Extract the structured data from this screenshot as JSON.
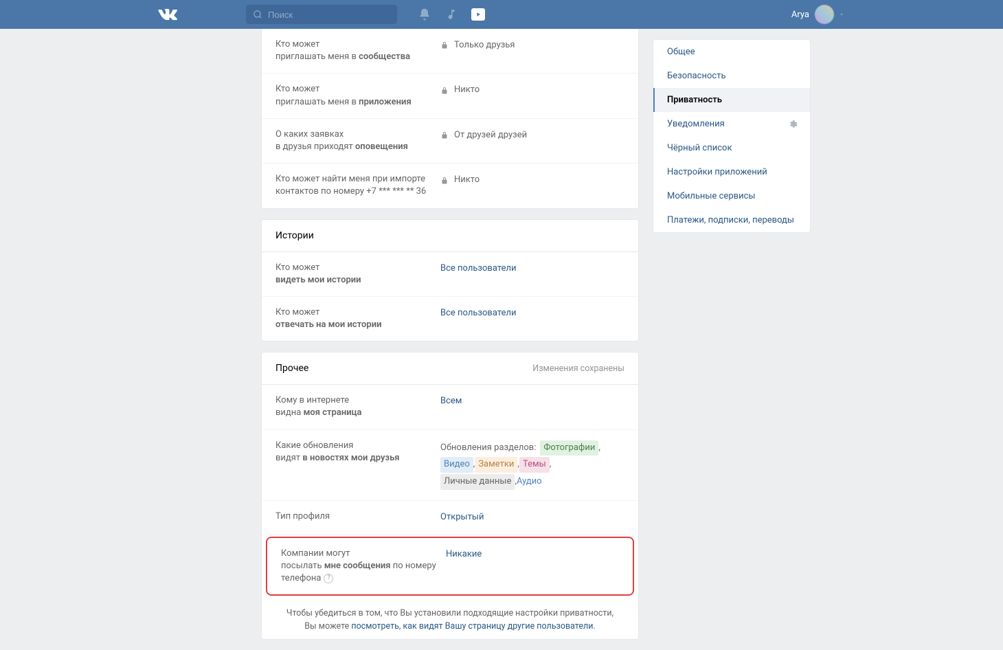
{
  "header": {
    "search_placeholder": "Поиск",
    "user_name": "Arya"
  },
  "sidebar": {
    "items": [
      {
        "label": "Общее",
        "active": false,
        "gear": false
      },
      {
        "label": "Безопасность",
        "active": false,
        "gear": false
      },
      {
        "label": "Приватность",
        "active": true,
        "gear": false
      },
      {
        "label": "Уведомления",
        "active": false,
        "gear": true
      },
      {
        "label": "Чёрный список",
        "active": false,
        "gear": false
      },
      {
        "label": "Настройки приложений",
        "active": false,
        "gear": false
      },
      {
        "label": "Мобильные сервисы",
        "active": false,
        "gear": false
      },
      {
        "label": "Платежи, подписки, переводы",
        "active": false,
        "gear": false
      }
    ]
  },
  "main": {
    "top_rows": [
      {
        "label_pre": "Кто может\nприглашать меня в ",
        "label_bold": "сообщества",
        "label_post": "",
        "value": "Только друзья",
        "locked": true
      },
      {
        "label_pre": "Кто может\nприглашать меня в ",
        "label_bold": "приложения",
        "label_post": "",
        "value": "Никто",
        "locked": true
      },
      {
        "label_pre": "О каких заявках\nв друзья приходят ",
        "label_bold": "оповещения",
        "label_post": "",
        "value": "От друзей друзей",
        "locked": true
      },
      {
        "label_pre": "Кто может найти меня при импорте контактов по номеру +7 *** *** ** 36",
        "label_bold": "",
        "label_post": "",
        "value": "Никто",
        "locked": true
      }
    ],
    "stories": {
      "title": "Истории",
      "rows": [
        {
          "label_pre": "Кто может\n",
          "label_bold": "видеть мои истории",
          "value": "Все пользователи"
        },
        {
          "label_pre": "Кто может\n",
          "label_bold": "отвечать на мои истории",
          "value": "Все пользователи"
        }
      ]
    },
    "other": {
      "title": "Прочее",
      "saved_text": "Изменения сохранены",
      "rows": [
        {
          "label_pre": "Кому в интернете\nвидна ",
          "label_bold": "моя страница",
          "value": "Всем",
          "type": "simple"
        },
        {
          "label_pre": "Какие обновления\nвидят ",
          "label_bold": "в новостях мои друзья",
          "type": "updates",
          "prefix": "Обновления разделов:",
          "tags": [
            {
              "text": "Фотографии",
              "class": "tag-green"
            },
            {
              "text": "Видео",
              "class": "tag-blue"
            },
            {
              "text": "Заметки",
              "class": "tag-orange"
            },
            {
              "text": "Темы",
              "class": "tag-pink"
            },
            {
              "text": "Личные данные",
              "class": "tag-gray"
            },
            {
              "text": "Аудио",
              "class": "tag-plain"
            }
          ]
        },
        {
          "label_pre": "Тип профиля",
          "label_bold": "",
          "value": "Открытый",
          "type": "simple"
        },
        {
          "label_pre": "Компании могут\nпосылать ",
          "label_bold": "мне сообщения",
          "label_post": " по номеру телефона",
          "help": true,
          "value": "Никакие",
          "type": "simple",
          "highlight": true
        }
      ]
    },
    "footer": {
      "line1": "Чтобы убедиться в том, что Вы установили подходящие настройки приватности,",
      "line2_pre": "Вы можете ",
      "line2_link": "посмотреть, как видят Вашу страницу другие пользователи."
    }
  }
}
